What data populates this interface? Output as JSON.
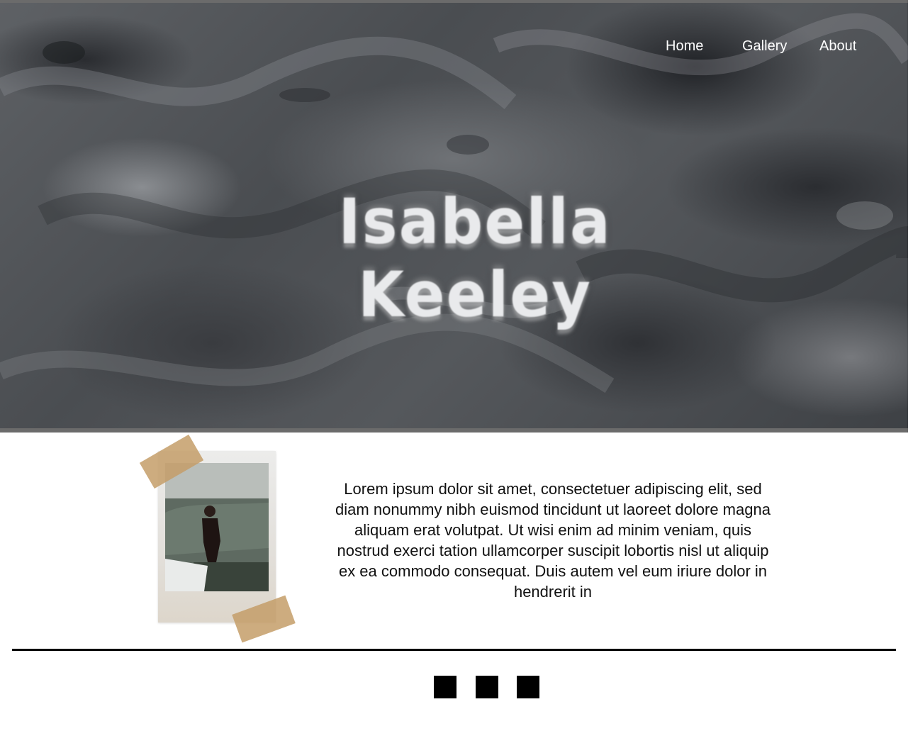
{
  "nav": {
    "home": "Home",
    "gallery": "Gallery",
    "about": "About"
  },
  "hero": {
    "title": "Isabella Keeley"
  },
  "bio": {
    "text": "Lorem ipsum dolor sit amet, consectetuer adipiscing elit, sed diam nonummy nibh euismod tincidunt ut laoreet dolore magna aliquam erat volutpat. Ut wisi enim ad minim veniam, quis nostrud exerci tation ullamcorper suscipit lobortis nisl ut aliquip ex ea commodo consequat. Duis autem vel eum iriure dolor in hendrerit in"
  },
  "footer": {
    "icons": [
      "square-icon",
      "square-icon",
      "square-icon"
    ]
  },
  "colors": {
    "hero_background": "#55585c",
    "nav_text": "#ffffff",
    "tape": "#c49e68",
    "rule": "#000000"
  }
}
